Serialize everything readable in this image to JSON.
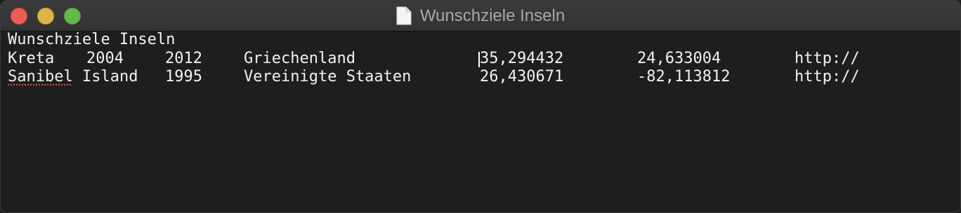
{
  "window": {
    "title": "Wunschziele Inseln",
    "title_icon": "document-icon"
  },
  "document": {
    "heading": "Wunschziele Inseln",
    "rows": [
      {
        "name": "Kreta",
        "year1": "2004",
        "year2": "2012",
        "country": "Griechenland",
        "lat": "35,294432",
        "lon": "24,633004",
        "link": "http://"
      },
      {
        "name": "Sanibel Island",
        "year1": "1995",
        "year2": "",
        "country": "Vereinigte Staaten",
        "lat": "26,430671",
        "lon": "-82,113812",
        "link": "http://"
      }
    ]
  }
}
